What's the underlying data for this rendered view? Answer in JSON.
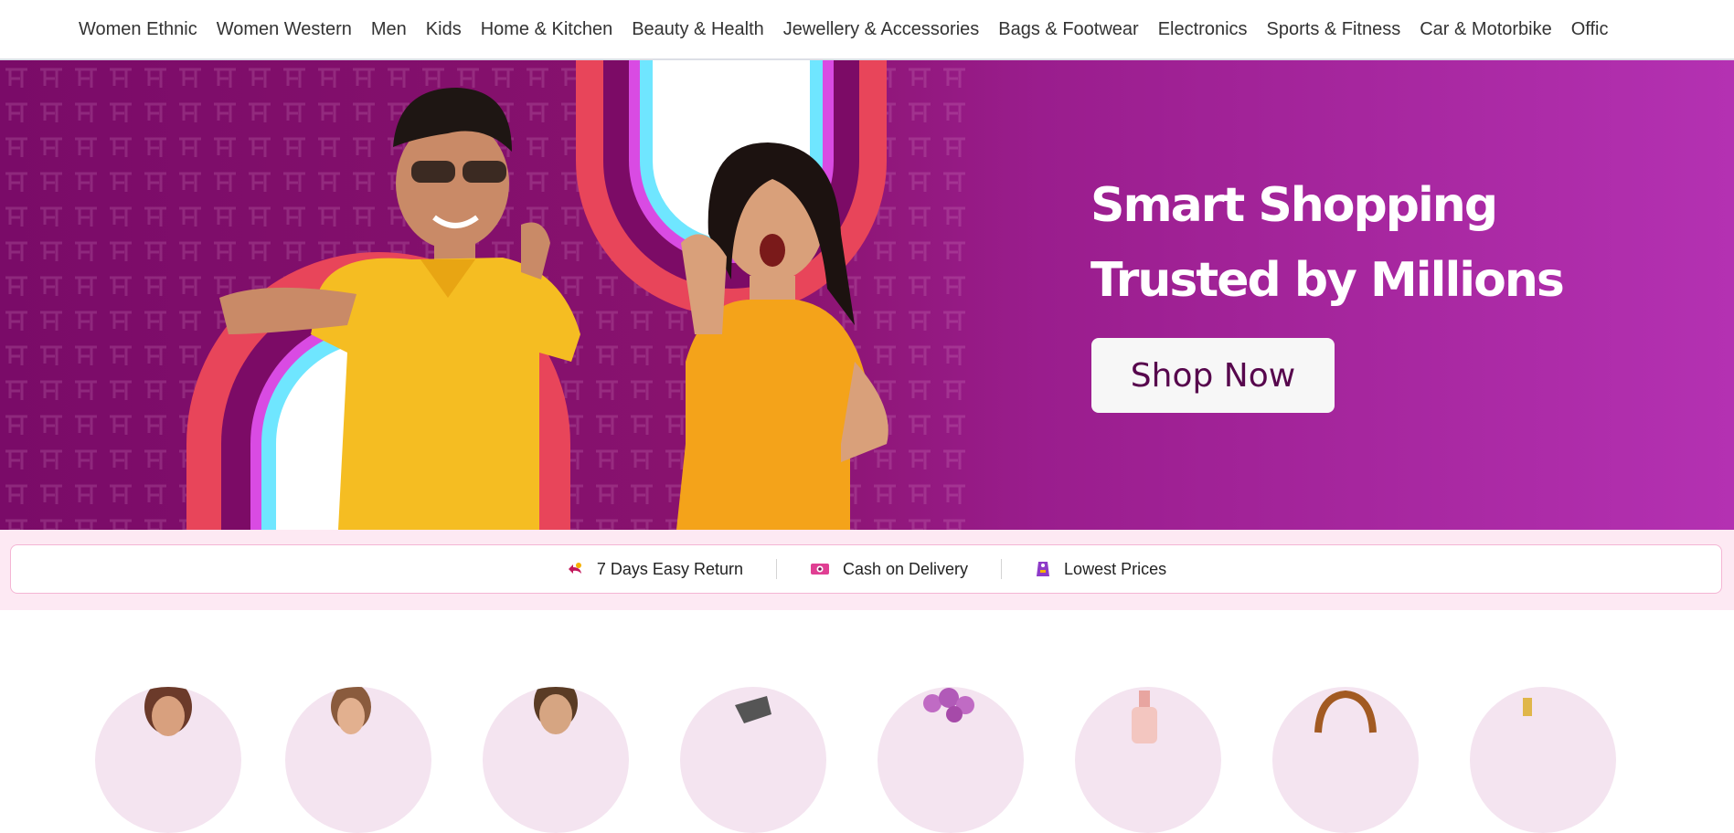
{
  "nav": {
    "items": [
      "Women Ethnic",
      "Women Western",
      "Men",
      "Kids",
      "Home & Kitchen",
      "Beauty & Health",
      "Jewellery & Accessories",
      "Bags & Footwear",
      "Electronics",
      "Sports & Fitness",
      "Car & Motorbike",
      "Offic"
    ]
  },
  "hero": {
    "line1": "Smart Shopping",
    "line2": "Trusted by Millions",
    "cta": "Shop Now"
  },
  "benefits": [
    {
      "label": "7 Days Easy Return",
      "icon": "return-icon"
    },
    {
      "label": "Cash on Delivery",
      "icon": "cash-icon"
    },
    {
      "label": "Lowest Prices",
      "icon": "price-tag-icon"
    }
  ],
  "colors": {
    "brand": "#9f2089",
    "hero_start": "#7a0b68",
    "hero_end": "#b431b2",
    "cta_text": "#57074d",
    "benefit_bg": "#fde9f3"
  }
}
